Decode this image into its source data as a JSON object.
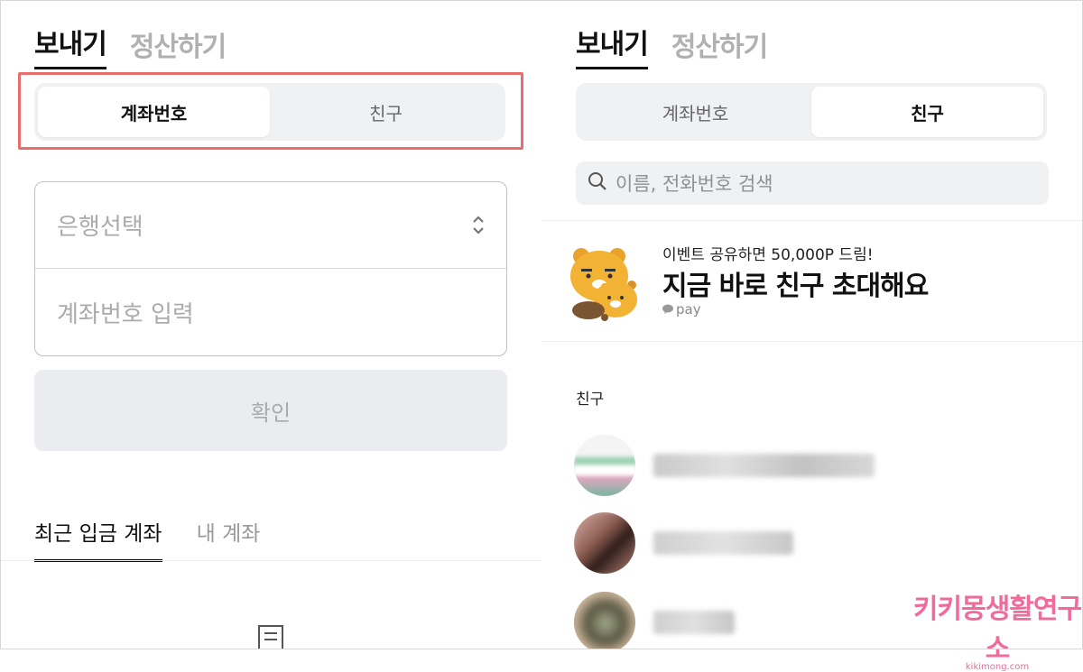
{
  "left": {
    "tabs": [
      "보내기",
      "정산하기"
    ],
    "segmented": [
      "계좌번호",
      "친구"
    ],
    "form": {
      "bank_placeholder": "은행선택",
      "account_placeholder": "계좌번호 입력"
    },
    "confirm_label": "확인",
    "sub_tabs": [
      "최근 입금 계좌",
      "내 계좌"
    ]
  },
  "right": {
    "tabs": [
      "보내기",
      "정산하기"
    ],
    "segmented": [
      "계좌번호",
      "친구"
    ],
    "search_placeholder": "이름, 전화번호 검색",
    "banner": {
      "small": "이벤트 공유하면 50,000P 드림!",
      "big": "지금 바로 친구 초대해요",
      "brand": "pay"
    },
    "friends_label": "친구"
  },
  "watermark": {
    "text": "키키몽생활연구소",
    "sub": "kikimong.com"
  },
  "colors": {
    "highlight": "#e86e6e",
    "watermark": "#f06a9b",
    "segment_bg": "#f0f1f3"
  },
  "icons": [
    "up-down-chevron-icon",
    "search-icon",
    "chat-bubble-icon",
    "list-icon",
    "ryan-character-icon"
  ]
}
